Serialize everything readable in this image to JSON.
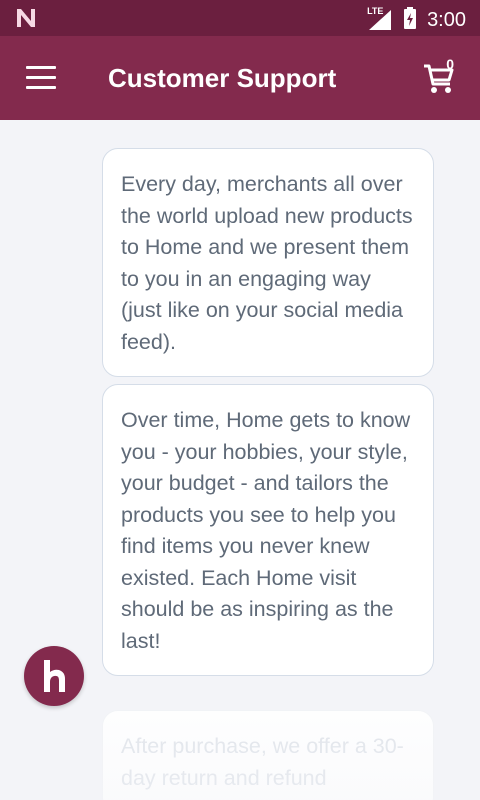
{
  "status_bar": {
    "network": "LTE",
    "time": "3:00",
    "icons": [
      "n-logo-icon",
      "signal-icon",
      "battery-charging-icon"
    ]
  },
  "app_bar": {
    "title": "Customer Support",
    "menu_icon": "menu-icon",
    "cart_icon": "cart-icon",
    "cart_count": "0"
  },
  "messages": [
    {
      "text": "Every day, merchants all over the world upload new products to Home and we present them to you in an engaging way (just like on your social media feed)."
    },
    {
      "text": "Over time, Home gets to know you - your hobbies, your style, your budget - and tailors the products you see to help you find items you never knew existed. Each Home visit should be as inspiring as the last!"
    },
    {
      "text": "After purchase, we offer a 30-day return and refund"
    }
  ],
  "fab": {
    "icon": "home-logo-icon"
  },
  "colors": {
    "status_bar": "#6b1f3f",
    "app_bar": "#832a4d",
    "background": "#f3f4f8",
    "bubble_text": "#5f6a78"
  }
}
